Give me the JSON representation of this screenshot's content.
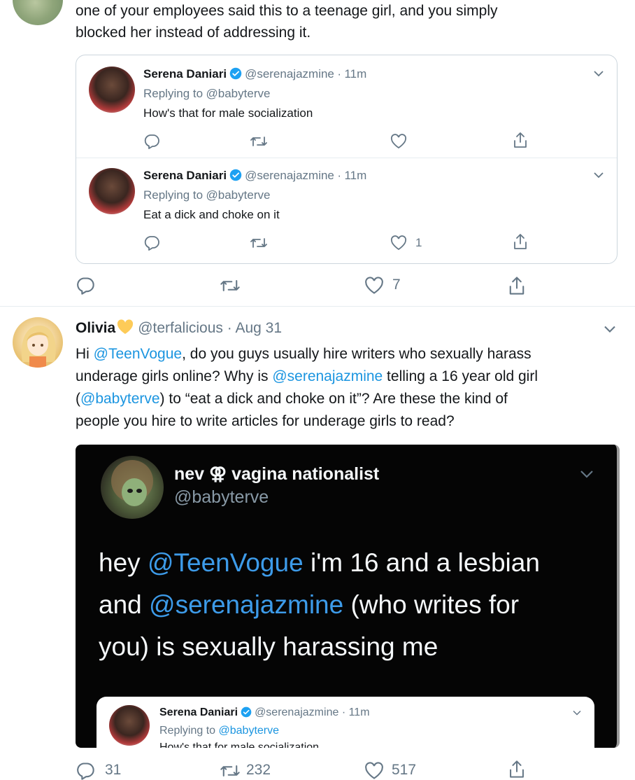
{
  "top_tweet": {
    "text_line1": "one of your employees said this to a teenage girl, and you simply",
    "text_line2": "blocked her instead of addressing it.",
    "quoted": [
      {
        "name": "Serena Daniari",
        "handle": "@serenajazmine",
        "sep": "·",
        "time": "11m",
        "replying_prefix": "Replying to",
        "replying_to": "@babyterve",
        "body": "How's that for male socialization",
        "like_count": ""
      },
      {
        "name": "Serena Daniari",
        "handle": "@serenajazmine",
        "sep": "·",
        "time": "11m",
        "replying_prefix": "Replying to",
        "replying_to": "@babyterve",
        "body": "Eat a dick and choke on it",
        "like_count": "1"
      }
    ],
    "actions": {
      "likes": "7"
    }
  },
  "olivia_tweet": {
    "name": "Olivia",
    "handle": "@terfalicious",
    "sep": "·",
    "date": "Aug 31",
    "l1_a": "Hi ",
    "l1_link": "@TeenVogue",
    "l1_b": ", do you guys usually hire writers who sexually harass",
    "l2_a": "underage girls online? Why is ",
    "l2_link": "@serenajazmine",
    "l2_b": " telling a 16 year old girl",
    "l3_a": "(",
    "l3_link": "@babyterve",
    "l3_b": ") to “eat a dick and choke on it”? Are these the kind of",
    "l4": "people you hire to write articles for underage girls to read?",
    "screenshot": {
      "name": "nev ⚢ vagina nationalist",
      "handle": "@babyterve",
      "line1_a": "hey ",
      "line1_link": "@TeenVogue",
      "line1_b": " i'm 16 and a lesbian",
      "line2_a": "and ",
      "line2_link": "@serenajazmine",
      "line2_b": " (who writes for",
      "line3": "you) is sexually harassing me",
      "inner": {
        "name": "Serena Daniari",
        "handle": "@serenajazmine",
        "sep": "·",
        "time": "11m",
        "replying_prefix": "Replying to",
        "replying_to": "@babyterve",
        "body_cut": "How's that for male socialization"
      }
    },
    "actions": {
      "replies": "31",
      "retweets": "232",
      "likes": "517"
    }
  },
  "colors": {
    "link": "#1b95e0",
    "verified": "#1da1f2",
    "icon": "#657786"
  }
}
